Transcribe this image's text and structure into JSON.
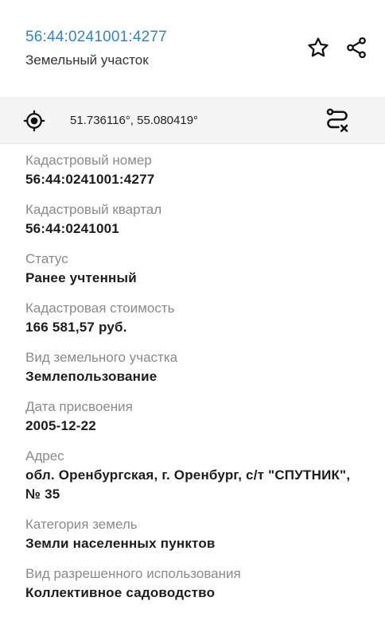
{
  "header": {
    "cadastral_number": "56:44:0241001:4277",
    "type": "Земельный участок"
  },
  "icons": {
    "favorite": "star-icon",
    "share": "share-icon",
    "locate": "crosshair-icon",
    "route": "route-icon"
  },
  "coords": {
    "text": "51.736116°, 55.080419°"
  },
  "fields": [
    {
      "label": "Кадастровый номер",
      "value": "56:44:0241001:4277"
    },
    {
      "label": "Кадастровый квартал",
      "value": "56:44:0241001"
    },
    {
      "label": "Статус",
      "value": "Ранее учтенный"
    },
    {
      "label": "Кадастровая стоимость",
      "value": "166 581,57 руб."
    },
    {
      "label": "Вид земельного участка",
      "value": "Землепользование"
    },
    {
      "label": "Дата присвоения",
      "value": "2005-12-22"
    },
    {
      "label": "Адрес",
      "value": "обл. Оренбургская, г. Оренбург, с/т \"СПУТНИК\", № 35"
    },
    {
      "label": "Категория земель",
      "value": "Земли населенных пунктов"
    },
    {
      "label": "Вид разрешенного использования",
      "value": "Коллективное садоводство"
    }
  ],
  "colors": {
    "link": "#2e86c1",
    "label": "#8a8a8a",
    "value": "#1c1c1c",
    "bar_bg": "#f4f4f4"
  }
}
